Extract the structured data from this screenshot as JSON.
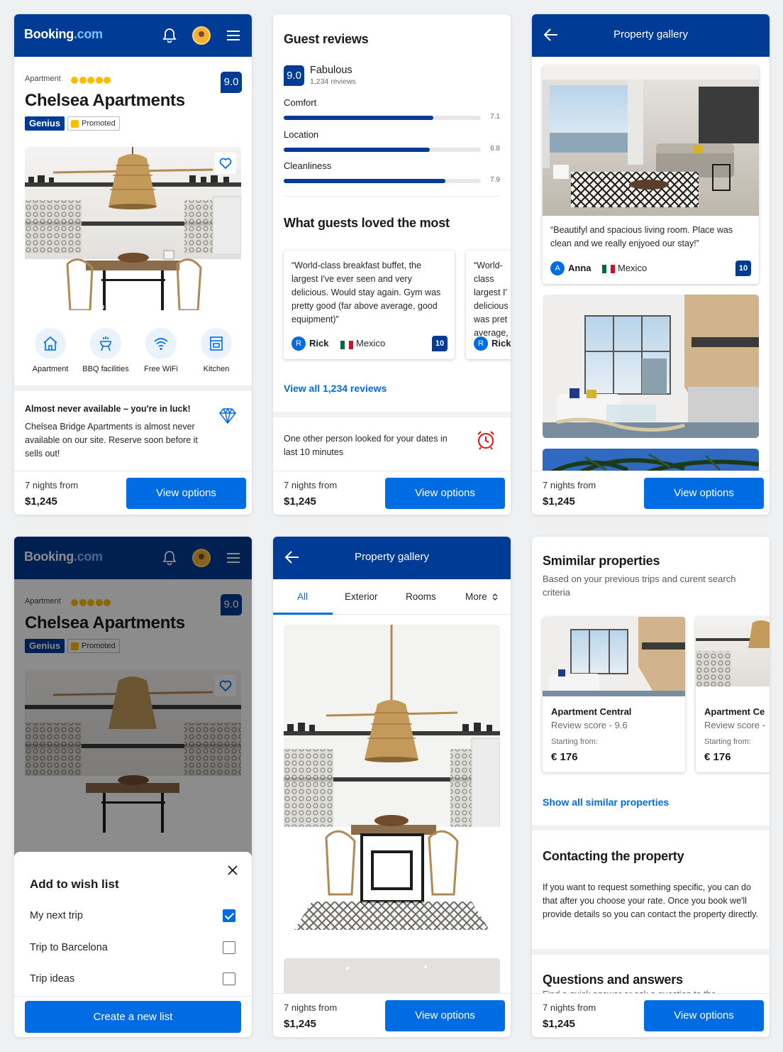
{
  "brand": {
    "logo_main": "Booking",
    "logo_dot": ".com"
  },
  "property": {
    "type": "Apartment",
    "stars": 5,
    "name": "Chelsea Apartments",
    "score": "9.0",
    "genius": "Genius",
    "promoted": "Promoted"
  },
  "facilities": [
    {
      "label": "Apartment",
      "icon": "home-icon"
    },
    {
      "label": "BBQ facilities",
      "icon": "bbq-icon"
    },
    {
      "label": "Free WiFi",
      "icon": "wifi-icon"
    },
    {
      "label": "Kitchen",
      "icon": "kitchen-icon"
    }
  ],
  "luck": {
    "title": "Almost never available – you're in luck!",
    "body": "Chelsea Bridge Apartments is almost never available on our site. Reserve soon before it sells out!",
    "icon": "diamond-icon"
  },
  "footer": {
    "nights": "7 nights from",
    "price": "$1,245",
    "cta": "View options"
  },
  "reviews": {
    "heading": "Guest reviews",
    "score": "9.0",
    "verdict": "Fabulous",
    "count": "1,234 reviews",
    "categories": [
      {
        "label": "Comfort",
        "value": "7.1",
        "fraction": 0.76
      },
      {
        "label": "Location",
        "value": "6.8",
        "fraction": 0.74
      },
      {
        "label": "Cleanliness",
        "value": "7.9",
        "fraction": 0.82
      }
    ],
    "loved_heading": "What guests loved the most",
    "loved": [
      {
        "text": "“World-class breakfast buffet, the largest I've ever seen and very delicious. Would stay again. Gym was pretty good (far above average, good equipment)”",
        "initial": "R",
        "name": "Rick",
        "country": "Mexico",
        "score": "10"
      },
      {
        "text": "“World-class largest I' delicious was pret average,",
        "initial": "R",
        "name": "Rick",
        "country": "Mexico",
        "score": "10"
      }
    ],
    "view_all": "View all 1,234 reviews"
  },
  "recent": {
    "text": "One other person looked for your dates in last 10 minutes",
    "icon": "alarm-clock-icon"
  },
  "gallery": {
    "title": "Property gallery",
    "caption": "“Beautifyl and spacious living room. Place was clean and we really enjyoed our stay!”",
    "reviewer": {
      "initial": "A",
      "name": "Anna",
      "country": "Mexico",
      "score": "10"
    },
    "tabs": [
      "All",
      "Exterior",
      "Rooms",
      "More"
    ]
  },
  "wishlist": {
    "title": "Add to wish list",
    "items": [
      {
        "label": "My next trip",
        "checked": true
      },
      {
        "label": "Trip to Barcelona",
        "checked": false
      },
      {
        "label": "Trip ideas",
        "checked": false
      }
    ],
    "create": "Create a new list"
  },
  "similar": {
    "heading": "Smimilar properties",
    "subheading": "Based on your previous trips and curent search criteria",
    "cards": [
      {
        "title": "Apartment Central",
        "score": "Review score - 9.6",
        "from": "Starting from:",
        "price": "€ 176"
      },
      {
        "title": "Apartment Ce",
        "score": "Review score -",
        "from": "Starting from:",
        "price": "€ 176"
      }
    ],
    "show_all": "Show all similar properties"
  },
  "contact": {
    "heading": "Contacting the property",
    "body": "If you want to request something specific, you can do that after you choose your rate. Once you book we'll provide details so you can contact the property directly."
  },
  "qa": {
    "heading": "Questions and answers",
    "sub": "Find a quick answer or ask a question to the"
  },
  "colors": {
    "primary": "#003b95",
    "action": "#006ce4",
    "star": "#febb02",
    "alert": "#e21111"
  }
}
